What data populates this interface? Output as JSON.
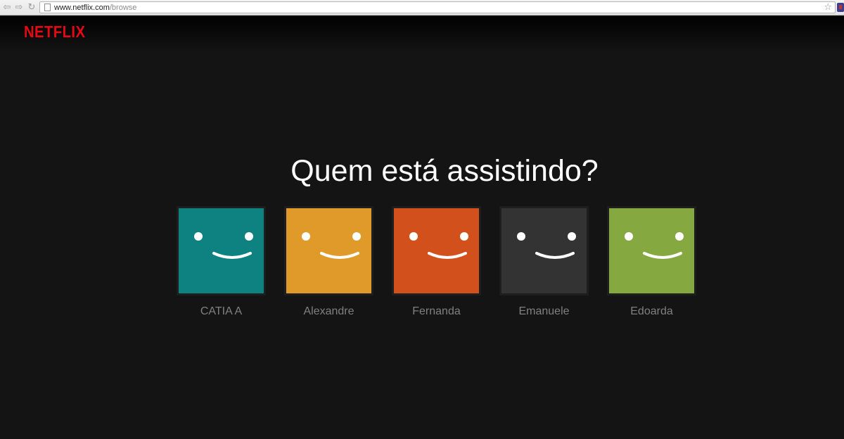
{
  "browser": {
    "url_host": "www.netflix.com",
    "url_path": "/browse",
    "back_icon": "back-arrow-icon",
    "forward_icon": "forward-arrow-icon",
    "reload_icon": "reload-icon",
    "bookmark_icon": "star-icon"
  },
  "header": {
    "logo_text": "NETFLIX",
    "logo_color": "#e50914"
  },
  "profile_gate": {
    "title": "Quem está assistindo?",
    "profiles": [
      {
        "name": "CATIA A",
        "color": "#0e8281"
      },
      {
        "name": "Alexandre",
        "color": "#e09a29"
      },
      {
        "name": "Fernanda",
        "color": "#d2501b"
      },
      {
        "name": "Emanuele",
        "color": "#333333"
      },
      {
        "name": "Edoarda",
        "color": "#85a840"
      }
    ]
  }
}
